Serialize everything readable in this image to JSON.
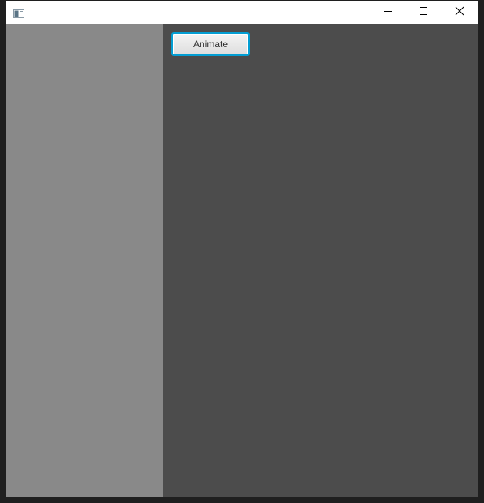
{
  "window": {
    "icons": {
      "app": "app-window-icon",
      "minimize": "minimize-icon",
      "maximize": "maximize-icon",
      "close": "close-icon"
    }
  },
  "content": {
    "animate_button_label": "Animate"
  },
  "colors": {
    "left_pane": "#898989",
    "right_pane": "#4c4c4c",
    "focus_border": "#039ed3",
    "titlebar": "#ffffff"
  }
}
